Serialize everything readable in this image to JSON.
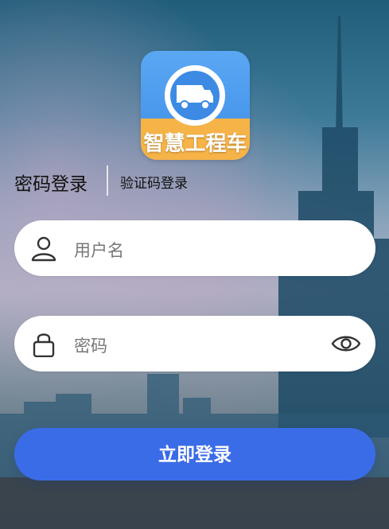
{
  "app": {
    "logo_text": "智慧工程车",
    "logo_icon": "dump-truck-icon"
  },
  "tabs": {
    "password_login": "密码登录",
    "code_login": "验证码登录"
  },
  "username": {
    "placeholder": "用户名",
    "icon": "user-icon"
  },
  "password": {
    "placeholder": "密码",
    "icon": "lock-icon",
    "toggle_icon": "eye-icon"
  },
  "login_button": {
    "label": "立即登录"
  },
  "colors": {
    "accent": "#3b6ce8",
    "logo_blue": "#4a9bee",
    "logo_orange": "#f6b347"
  }
}
